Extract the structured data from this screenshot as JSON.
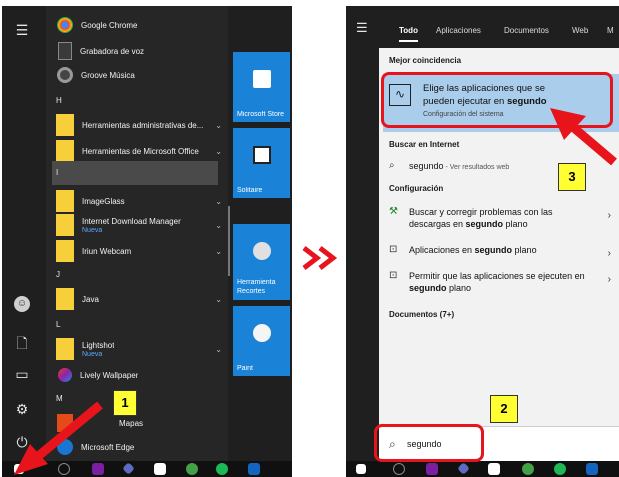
{
  "left": {
    "apps_top": [
      {
        "name": "Google Chrome"
      },
      {
        "name": "Grabadora de voz"
      },
      {
        "name": "Groove Música"
      }
    ],
    "letter_h": "H",
    "apps_h": [
      {
        "name": "Herramientas administrativas de...",
        "chevron": "⌄"
      },
      {
        "name": "Herramientas de Microsoft Office",
        "chevron": "⌄"
      }
    ],
    "letter_i": "I",
    "apps_i": [
      {
        "name": "ImageGlass",
        "chevron": "⌄"
      },
      {
        "name": "Internet Download Manager",
        "sub": "Nueva",
        "chevron": "⌄"
      },
      {
        "name": "Iriun Webcam",
        "chevron": "⌄"
      }
    ],
    "letter_j": "J",
    "apps_j": [
      {
        "name": "Java",
        "chevron": "⌄"
      }
    ],
    "letter_l": "L",
    "apps_l": [
      {
        "name": "Lightshot",
        "sub": "Nueva",
        "chevron": "⌄"
      },
      {
        "name": "Lively Wallpaper"
      }
    ],
    "letter_m": "M",
    "apps_m": [
      {
        "name": "Mapas"
      },
      {
        "name": "Microsoft Edge"
      }
    ],
    "tiles": [
      {
        "label": "Microsoft Store",
        "icon": "store-icon"
      },
      {
        "label": "Solitaire",
        "icon": "cards-icon"
      },
      {
        "label": "Herramienta Recortes",
        "icon": "scissors-icon"
      },
      {
        "label": "Paint",
        "icon": "palette-icon"
      }
    ],
    "badge": "1"
  },
  "right": {
    "tabs": [
      "Todo",
      "Aplicaciones",
      "Documentos",
      "Web",
      "M"
    ],
    "best_match_header": "Mejor coincidencia",
    "best_match_title_a": "Elige las aplicaciones que se pueden ejecutar en ",
    "best_match_title_b": "segundo",
    "best_match_sub": "Configuración del sistema",
    "web_header": "Buscar en Internet",
    "web_query": "segundo",
    "web_suffix": " - Ver resultados web",
    "config_header": "Configuración",
    "config_items": [
      {
        "a": "Buscar y corregir problemas con las descargas en ",
        "b": "segundo",
        "c": " plano"
      },
      {
        "a": "Aplicaciones en ",
        "b": "segundo",
        "c": " plano"
      },
      {
        "a": "Permitir que las aplicaciones se ejecuten en ",
        "b": "segundo",
        "c": " plano"
      }
    ],
    "docs_header": "Documentos (7+)",
    "search_value": "segundo",
    "badge_2": "2",
    "badge_3": "3"
  },
  "colors": {
    "accent_tile": "#1a83d8",
    "best_match_bg": "#a9cdeb",
    "annotation_red": "#e8141c",
    "badge_yellow": "#ffff33"
  }
}
